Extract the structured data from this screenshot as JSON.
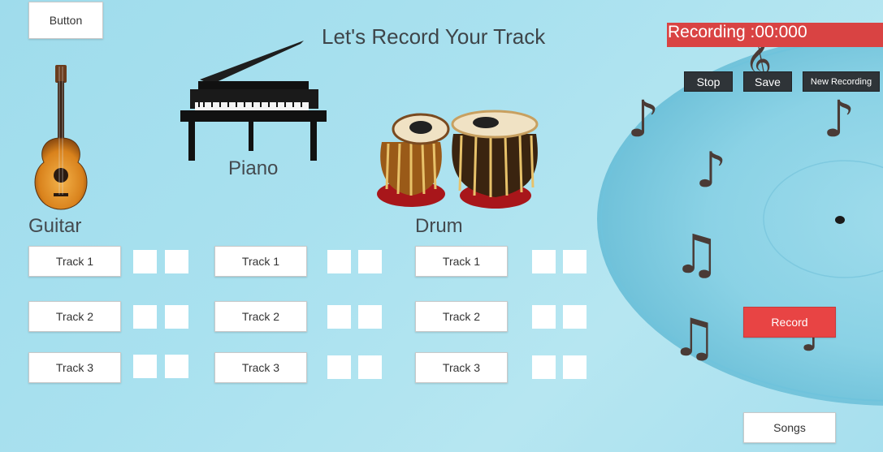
{
  "header": {
    "title": "Let's Record Your Track"
  },
  "top_button": {
    "label": "Button"
  },
  "instruments": {
    "guitar": {
      "label": "Guitar"
    },
    "piano": {
      "label": "Piano"
    },
    "drum": {
      "label": "Drum"
    }
  },
  "tracks": {
    "guitar": [
      "Track 1",
      "Track 2",
      "Track 3"
    ],
    "piano": [
      "Track 1",
      "Track 2",
      "Track 3"
    ],
    "drum": [
      "Track 1",
      "Track 2",
      "Track 3"
    ]
  },
  "recording": {
    "status": "Recording :00:000",
    "stop_label": "Stop",
    "save_label": "Save",
    "new_label": "New Recording",
    "record_label": "Record",
    "songs_label": "Songs"
  },
  "colors": {
    "accent_red": "#d94343",
    "record_button": "#e84444",
    "dark_button": "#2f3438"
  }
}
